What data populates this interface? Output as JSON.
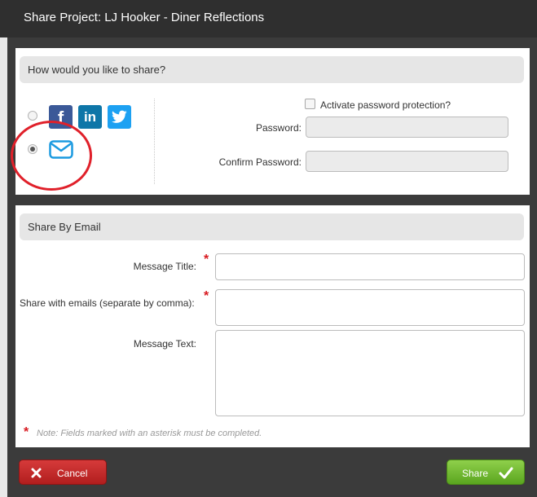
{
  "window": {
    "title": "Share Project: LJ Hooker - Diner Reflections"
  },
  "share_section": {
    "header": "How would you like to share?",
    "options": [
      {
        "icons": [
          "facebook-icon",
          "linkedin-icon",
          "twitter-icon"
        ],
        "selected": false
      },
      {
        "icons": [
          "email-icon"
        ],
        "selected": true
      }
    ],
    "password_protection_label": "Activate password protection?",
    "password_protection_checked": false,
    "password_label": "Password:",
    "password_value": "",
    "confirm_password_label": "Confirm Password:",
    "confirm_password_value": "",
    "social_glyphs": {
      "facebook": "f",
      "linkedin": "in"
    }
  },
  "email_section": {
    "header": "Share By Email",
    "message_title_label": "Message Title:",
    "message_title_value": "",
    "emails_label": "Share with emails (separate by comma):",
    "emails_value": "",
    "message_text_label": "Message Text:",
    "message_text_value": "",
    "required_marker": "*",
    "note": "Note: Fields marked with an asterisk must be completed."
  },
  "footer": {
    "cancel_label": "Cancel",
    "share_label": "Share"
  },
  "colors": {
    "cancel": "#c62828",
    "share": "#6cb82f",
    "highlight_circle": "#e0202a",
    "facebook": "#3b5998",
    "linkedin": "#0e76a8",
    "twitter": "#1da1f2",
    "email_icon": "#1b9ae0"
  }
}
